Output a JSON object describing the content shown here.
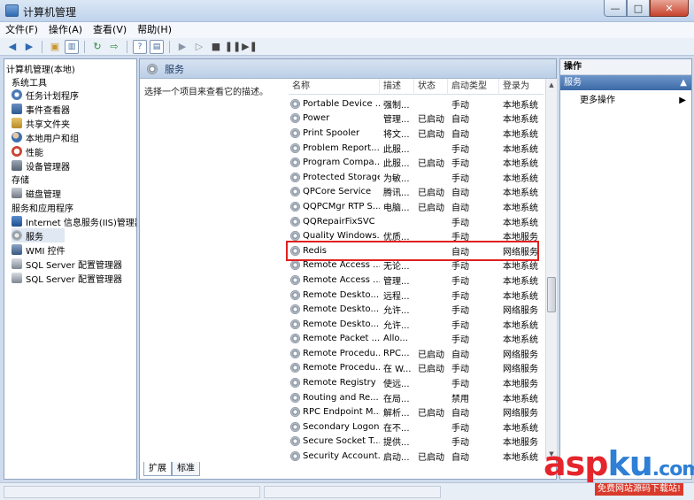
{
  "window": {
    "title": "计算机管理",
    "minimize": "—",
    "maximize": "□",
    "close": "✕"
  },
  "menu": [
    "文件(F)",
    "操作(A)",
    "查看(V)",
    "帮助(H)"
  ],
  "toolbar_icons": [
    "back-arrow",
    "forward-arrow",
    "up-folder",
    "show-hide-tree",
    "refresh",
    "export",
    "help",
    "properties",
    "play",
    "play-alt",
    "stop",
    "pause",
    "restart"
  ],
  "tree": {
    "root": "计算机管理(本地)",
    "system_tools": "系统工具",
    "task_scheduler": "任务计划程序",
    "event_viewer": "事件查看器",
    "shared_folders": "共享文件夹",
    "local_users": "本地用户和组",
    "performance": "性能",
    "device_manager": "设备管理器",
    "storage": "存储",
    "disk_mgmt": "磁盘管理",
    "services_apps": "服务和应用程序",
    "iis": "Internet 信息服务(IIS)管理器",
    "services": "服务",
    "wmi": "WMI 控件",
    "sql1": "SQL Server 配置管理器",
    "sql2": "SQL Server 配置管理器"
  },
  "center": {
    "header": "服务",
    "description": "选择一个项目来查看它的描述。",
    "columns": {
      "name": "名称",
      "desc": "描述",
      "status": "状态",
      "startup": "启动类型",
      "logon": "登录为"
    },
    "services": [
      {
        "name": "Portable Device ...",
        "desc": "强制...",
        "status": "",
        "startup": "手动",
        "logon": "本地系统"
      },
      {
        "name": "Power",
        "desc": "管理...",
        "status": "已启动",
        "startup": "自动",
        "logon": "本地系统"
      },
      {
        "name": "Print Spooler",
        "desc": "将文...",
        "status": "已启动",
        "startup": "自动",
        "logon": "本地系统"
      },
      {
        "name": "Problem Report...",
        "desc": "此服...",
        "status": "",
        "startup": "手动",
        "logon": "本地系统"
      },
      {
        "name": "Program Compa...",
        "desc": "此服...",
        "status": "已启动",
        "startup": "手动",
        "logon": "本地系统"
      },
      {
        "name": "Protected Storage",
        "desc": "为敏...",
        "status": "",
        "startup": "手动",
        "logon": "本地系统"
      },
      {
        "name": "QPCore Service",
        "desc": "腾讯...",
        "status": "已启动",
        "startup": "自动",
        "logon": "本地系统"
      },
      {
        "name": "QQPCMgr RTP S...",
        "desc": "电脑...",
        "status": "已启动",
        "startup": "自动",
        "logon": "本地系统"
      },
      {
        "name": "QQRepairFixSVC",
        "desc": "",
        "status": "",
        "startup": "手动",
        "logon": "本地系统"
      },
      {
        "name": "Quality Windows...",
        "desc": "优质...",
        "status": "",
        "startup": "手动",
        "logon": "本地服务"
      },
      {
        "name": "Redis",
        "desc": "",
        "status": "",
        "startup": "自动",
        "logon": "网络服务"
      },
      {
        "name": "Remote Access ...",
        "desc": "无论...",
        "status": "",
        "startup": "手动",
        "logon": "本地系统"
      },
      {
        "name": "Remote Access ...",
        "desc": "管理...",
        "status": "",
        "startup": "手动",
        "logon": "本地系统"
      },
      {
        "name": "Remote Deskto...",
        "desc": "远程...",
        "status": "",
        "startup": "手动",
        "logon": "本地系统"
      },
      {
        "name": "Remote Deskto...",
        "desc": "允许...",
        "status": "",
        "startup": "手动",
        "logon": "网络服务"
      },
      {
        "name": "Remote Deskto...",
        "desc": "允许...",
        "status": "",
        "startup": "手动",
        "logon": "本地系统"
      },
      {
        "name": "Remote Packet ...",
        "desc": "Allo...",
        "status": "",
        "startup": "手动",
        "logon": "本地系统"
      },
      {
        "name": "Remote Procedu...",
        "desc": "RPC...",
        "status": "已启动",
        "startup": "自动",
        "logon": "网络服务"
      },
      {
        "name": "Remote Procedu...",
        "desc": "在 W...",
        "status": "已启动",
        "startup": "手动",
        "logon": "网络服务"
      },
      {
        "name": "Remote Registry",
        "desc": "使远...",
        "status": "",
        "startup": "手动",
        "logon": "本地服务"
      },
      {
        "name": "Routing and Re...",
        "desc": "在局...",
        "status": "",
        "startup": "禁用",
        "logon": "本地系统"
      },
      {
        "name": "RPC Endpoint M...",
        "desc": "解析...",
        "status": "已启动",
        "startup": "自动",
        "logon": "网络服务"
      },
      {
        "name": "Secondary Logon",
        "desc": "在不...",
        "status": "",
        "startup": "手动",
        "logon": "本地系统"
      },
      {
        "name": "Secure Socket T...",
        "desc": "提供...",
        "status": "",
        "startup": "手动",
        "logon": "本地服务"
      },
      {
        "name": "Security Account...",
        "desc": "启动...",
        "status": "已启动",
        "startup": "自动",
        "logon": "本地系统"
      }
    ],
    "tabs": {
      "extended": "扩展",
      "standard": "标准"
    }
  },
  "right": {
    "title": "操作",
    "group": "服务",
    "more": "更多操作",
    "group_arrow": "▲",
    "more_arrow": "▶"
  },
  "watermark": {
    "asp": "asp",
    "ku": "ku",
    "com": ".com",
    "sub": "免费网站源码下载站!"
  }
}
